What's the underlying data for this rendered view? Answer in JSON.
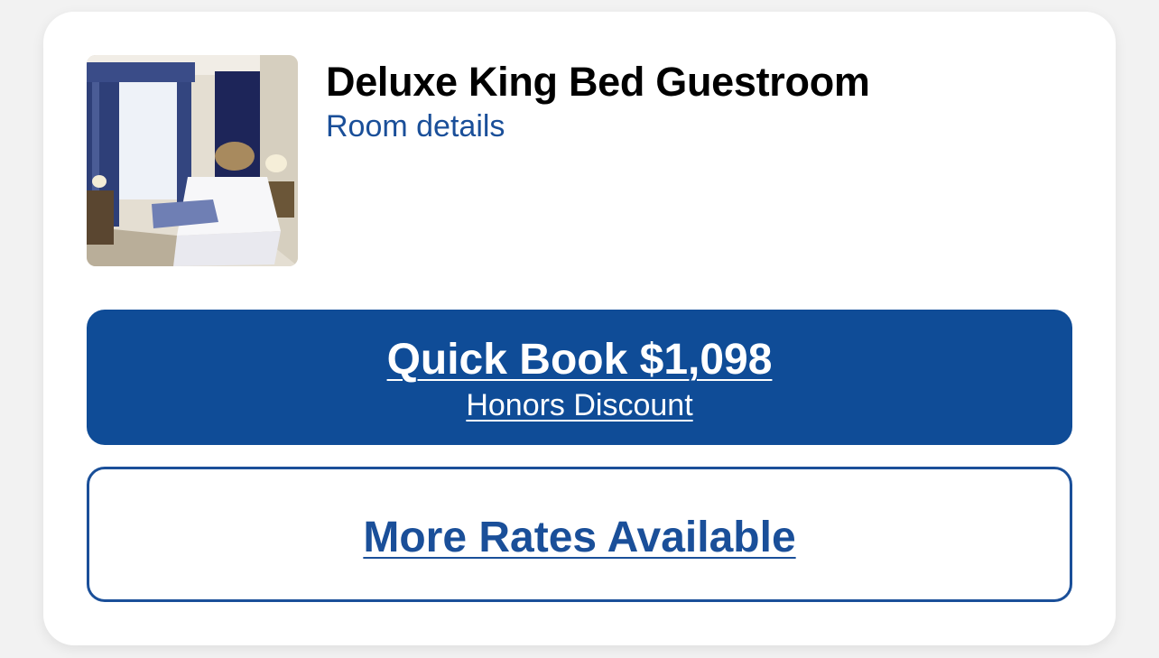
{
  "room": {
    "name": "Deluxe King Bed Guestroom",
    "details_link": "Room details",
    "image_icon": "room-photo"
  },
  "quick_book": {
    "label": "Quick Book $1,098",
    "rate_name": "Honors Discount"
  },
  "more_rates": {
    "label": "More Rates Available"
  },
  "colors": {
    "primary": "#0f4c97",
    "link": "#1a4f99",
    "page_bg": "#f2f2f2",
    "card_bg": "#ffffff"
  }
}
